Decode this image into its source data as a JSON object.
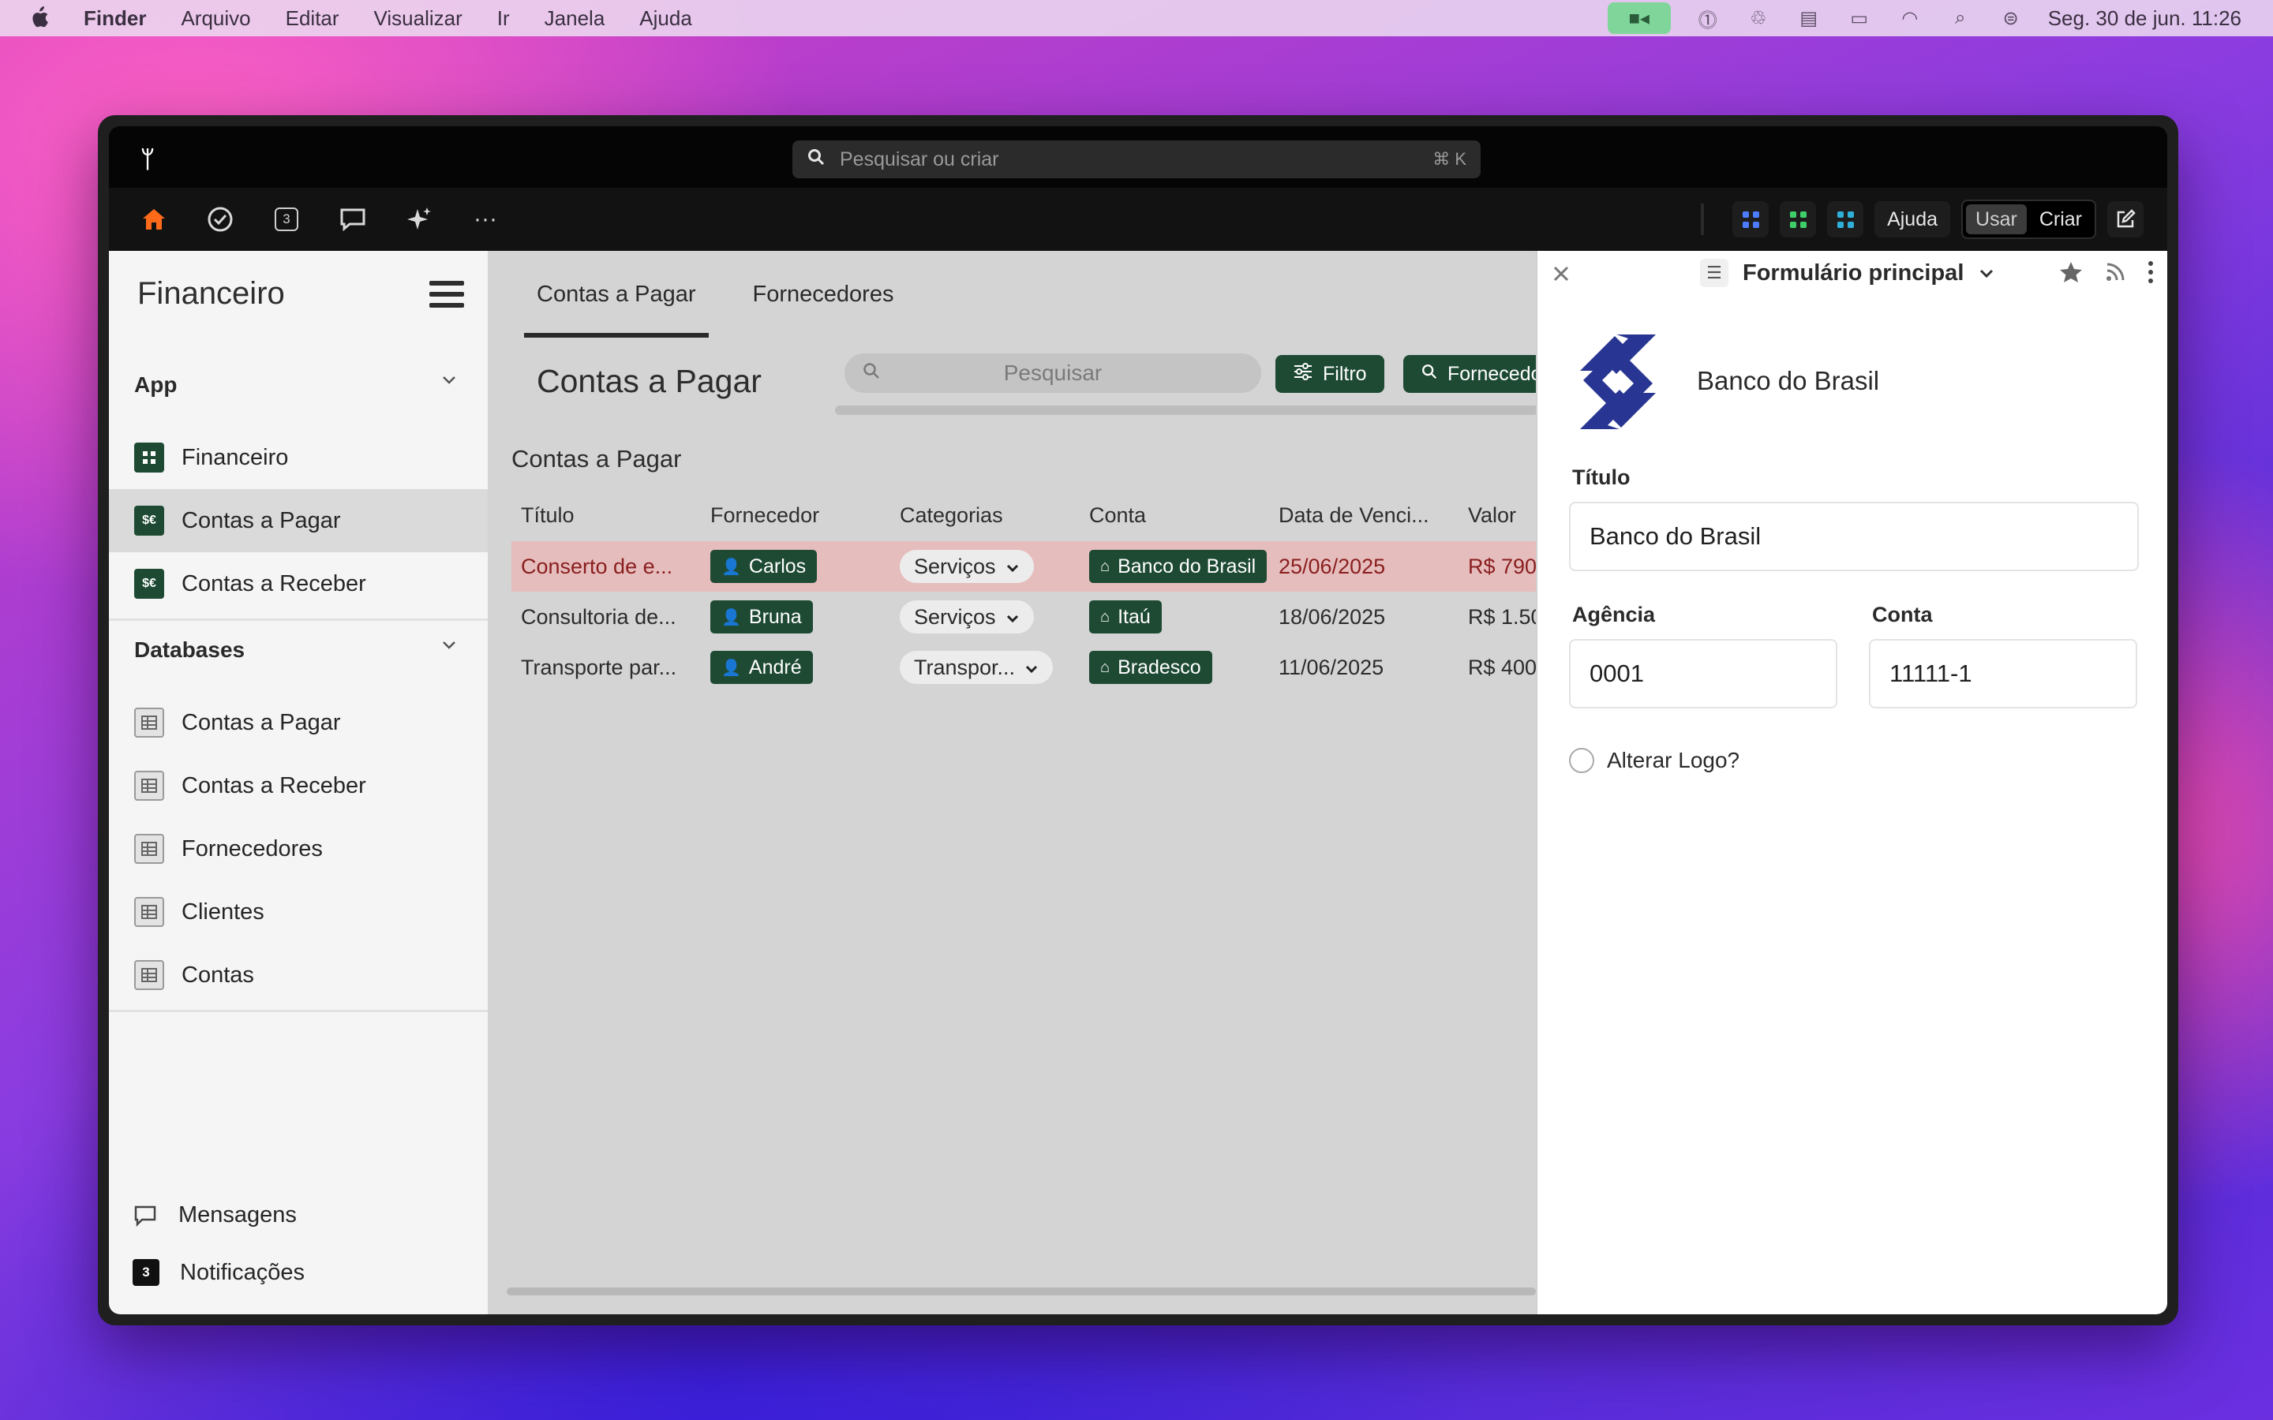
{
  "colors": {
    "accent_green": "#1e4a34",
    "home_orange": "#ff6a1a",
    "bb_blue": "#283593",
    "row_highlight": "#e6bdbd"
  },
  "menubar": {
    "app": "Finder",
    "items": [
      "Arquivo",
      "Editar",
      "Visualizar",
      "Ir",
      "Janela",
      "Ajuda"
    ],
    "clock": "Seg. 30 de jun.  11:26",
    "status_icons": [
      "video-camera-icon",
      "one-password-icon",
      "teams-icon",
      "window-icon",
      "battery-icon",
      "wifi-icon",
      "search-icon",
      "control-center-icon"
    ]
  },
  "app": {
    "logo": "ᛘ",
    "search": {
      "placeholder": "Pesquisar ou criar",
      "shortcut": "⌘ K"
    },
    "toolbar": {
      "notification_count": "3",
      "more": "···",
      "help": "Ajuda",
      "mode_use": "Usar",
      "mode_create": "Criar"
    }
  },
  "sidebar": {
    "title": "Financeiro",
    "app_section": "App",
    "app_items": [
      {
        "label": "Financeiro",
        "icon": "grid-icon"
      },
      {
        "label": "Contas a Pagar",
        "icon": "money-icon",
        "badge": "$€"
      },
      {
        "label": "Contas a Receber",
        "icon": "money-icon",
        "badge": "$€"
      }
    ],
    "db_section": "Databases",
    "db_items": [
      "Contas a Pagar",
      "Contas a Receber",
      "Fornecedores",
      "Clientes",
      "Contas"
    ],
    "footer": {
      "messages": "Mensagens",
      "notifications": "Notificações",
      "notification_count": "3"
    }
  },
  "main": {
    "tabs": [
      "Contas a Pagar",
      "Fornecedores"
    ],
    "page_title": "Contas a Pagar",
    "search_placeholder": "Pesquisar",
    "filter_button": "Filtro",
    "supplier_button": "Fornecedor",
    "section_title": "Contas a Pagar",
    "columns": [
      "Título",
      "Fornecedor",
      "Categorias",
      "Conta",
      "Data de Venci...",
      "Valor"
    ],
    "rows": [
      {
        "titulo": "Conserto de e...",
        "fornecedor": "Carlos",
        "categoria": "Serviços",
        "conta": "Banco do Brasil",
        "data": "25/06/2025",
        "valor": "R$ 790"
      },
      {
        "titulo": "Consultoria de...",
        "fornecedor": "Bruna",
        "categoria": "Serviços",
        "conta": "Itaú",
        "data": "18/06/2025",
        "valor": "R$ 1.50"
      },
      {
        "titulo": "Transporte par...",
        "fornecedor": "André",
        "categoria": "Transpor...",
        "conta": "Bradesco",
        "data": "11/06/2025",
        "valor": "R$ 400"
      }
    ]
  },
  "panel": {
    "form_name": "Formulário principal",
    "bank_name": "Banco do Brasil",
    "fields": {
      "titulo_label": "Título",
      "titulo_value": "Banco do Brasil",
      "agencia_label": "Agência",
      "agencia_value": "0001",
      "conta_label": "Conta",
      "conta_value": "11111-1"
    },
    "checkbox_label": "Alterar Logo?"
  }
}
